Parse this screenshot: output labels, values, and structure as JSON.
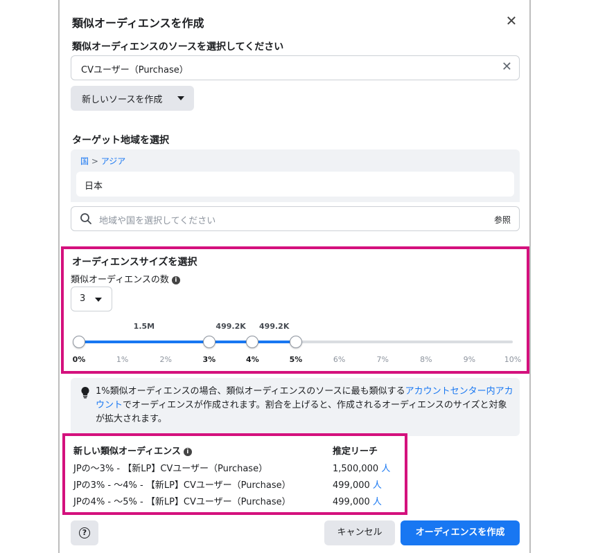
{
  "dialog": {
    "title": "類似オーディエンスを作成",
    "close_symbol": "✕"
  },
  "source": {
    "label": "類似オーディエンスのソースを選択してください",
    "value": "CVユーザー（Purchase）",
    "new_source_label": "新しいソースを作成"
  },
  "region": {
    "label": "ターゲット地域を選択",
    "breadcrumb_root": "国",
    "breadcrumb_sep": " > ",
    "breadcrumb_child": "アジア",
    "selected_country": "日本",
    "search_placeholder": "地域や国を選択してください",
    "browse_label": "参照"
  },
  "size": {
    "label": "オーディエンスサイズを選択",
    "count_label": "類似オーディエンスの数",
    "count_value": "3",
    "ticks": [
      "0%",
      "1%",
      "2%",
      "3%",
      "4%",
      "5%",
      "6%",
      "7%",
      "8%",
      "9%",
      "10%"
    ],
    "selected_ticks": [
      0,
      3,
      4,
      5
    ],
    "segment_labels": [
      "1.5M",
      "499.2K",
      "499.2K"
    ]
  },
  "info": {
    "text_before": "1%類似オーディエンスの場合、類似オーディエンスのソースに最も類似する",
    "link": "アカウントセンター内アカウント",
    "text_after": "でオーディエンスが作成されます。割合を上げると、作成されるオーディエンスのサイズと対象が拡大されます。"
  },
  "table": {
    "name_header": "新しい類似オーディエンス",
    "reach_header": "推定リーチ",
    "rows": [
      {
        "name": "JPの～3% - 【新LP】CVユーザー（Purchase）",
        "reach": "1,500,000",
        "unit": "人"
      },
      {
        "name": "JPの3% - ～4% - 【新LP】CVユーザー（Purchase）",
        "reach": "499,000",
        "unit": "人"
      },
      {
        "name": "JPの4% - ～5% - 【新LP】CVユーザー（Purchase）",
        "reach": "499,000",
        "unit": "人"
      }
    ]
  },
  "footer": {
    "help_symbol": "?",
    "cancel_label": "キャンセル",
    "create_label": "オーディエンスを作成"
  },
  "colors": {
    "accent": "#1877f2",
    "highlight": "#d4117d"
  }
}
